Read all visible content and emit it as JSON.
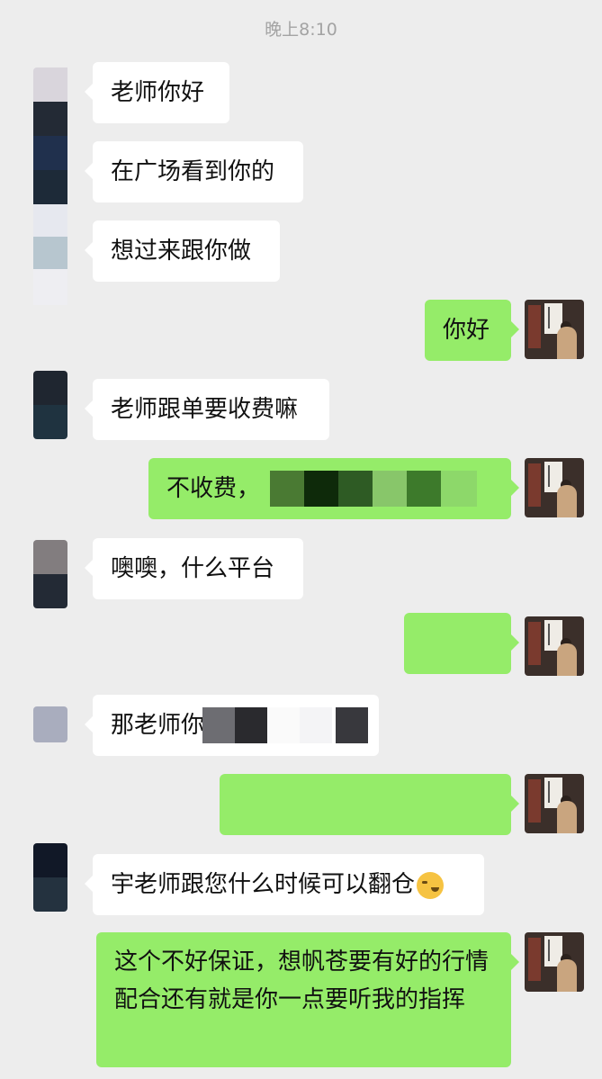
{
  "chat": {
    "timestamp": "晚上8:10",
    "messages": [
      {
        "side": "left",
        "text": "老师你好"
      },
      {
        "side": "left",
        "text": "在广场看到你的"
      },
      {
        "side": "left",
        "text": "想过来跟你做"
      },
      {
        "side": "right",
        "text": "你好"
      },
      {
        "side": "left",
        "text": "老师跟单要收费嘛"
      },
      {
        "side": "right",
        "text": "不收费，"
      },
      {
        "side": "left",
        "text": "噢噢，什么平台"
      },
      {
        "side": "right",
        "text": ""
      },
      {
        "side": "left",
        "text": "那老师你"
      },
      {
        "side": "right",
        "text": ""
      },
      {
        "side": "left",
        "text": "宇老师跟您什么时候可以翻仓"
      },
      {
        "side": "right",
        "text": "这个不好保证，想帆苍要有好的行情配合还有就是你一点要听我的指挥"
      }
    ]
  },
  "icons": {
    "emoji": "crying-laughing-emoji-icon",
    "teacher_avatar": "teacher-avatar-icon",
    "user_avatar": "pixelated-user-avatar-icon"
  },
  "colors": {
    "background": "#ededed",
    "incoming_bubble": "#ffffff",
    "outgoing_bubble": "#95ec69",
    "timestamp": "#a3a3a3"
  }
}
